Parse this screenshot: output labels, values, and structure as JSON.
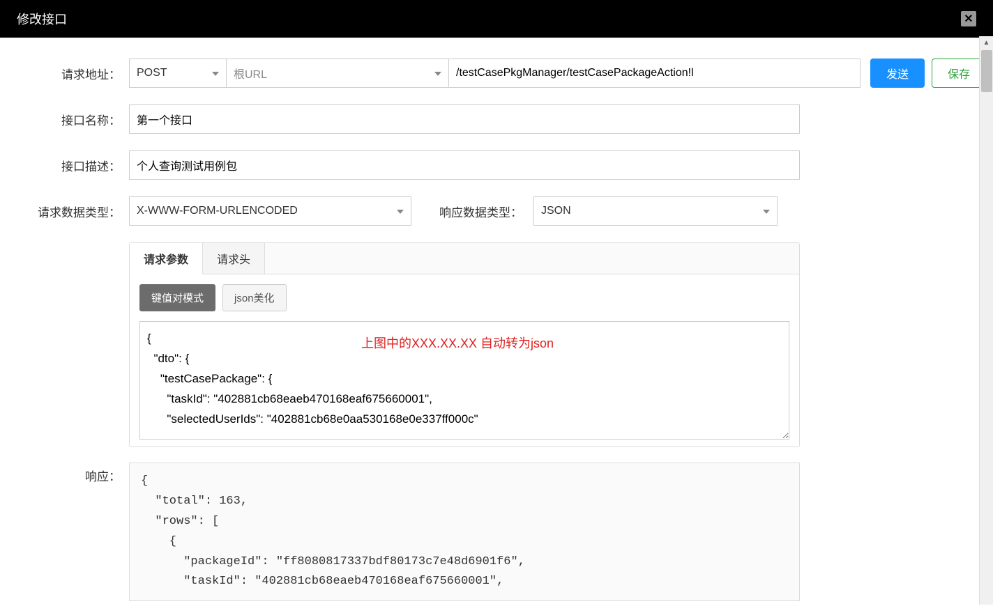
{
  "header": {
    "title": "修改接口"
  },
  "form": {
    "url_label": "请求地址：",
    "method": "POST",
    "root_url_placeholder": "根URL",
    "path": "/testCasePkgManager/testCasePackageAction!l",
    "send_btn": "发送",
    "save_btn": "保存",
    "name_label": "接口名称：",
    "name_value": "第一个接口",
    "desc_label": "接口描述：",
    "desc_value": "个人查询测试用例包",
    "req_type_label": "请求数据类型：",
    "req_type_value": "X-WWW-FORM-URLENCODED",
    "res_type_label": "响应数据类型：",
    "res_type_value": "JSON"
  },
  "tabs": {
    "params": "请求参数",
    "headers": "请求头"
  },
  "modes": {
    "kv": "键值对模式",
    "json_fmt": "json美化"
  },
  "overlay": "上图中的XXX.XX.XX 自动转为json",
  "request_body": "{\n  \"dto\": {\n    \"testCasePackage\": {\n      \"taskId\": \"402881cb68eaeb470168eaf675660001\",\n      \"selectedUserIds\": \"402881cb68e0aa530168e0e337ff000c\"",
  "response_label": "响应：",
  "response_body": "{\n  \"total\": 163,\n  \"rows\": [\n    {\n      \"packageId\": \"ff8080817337bdf80173c7e48d6901f6\",\n      \"taskId\": \"402881cb68eaeb470168eaf675660001\","
}
